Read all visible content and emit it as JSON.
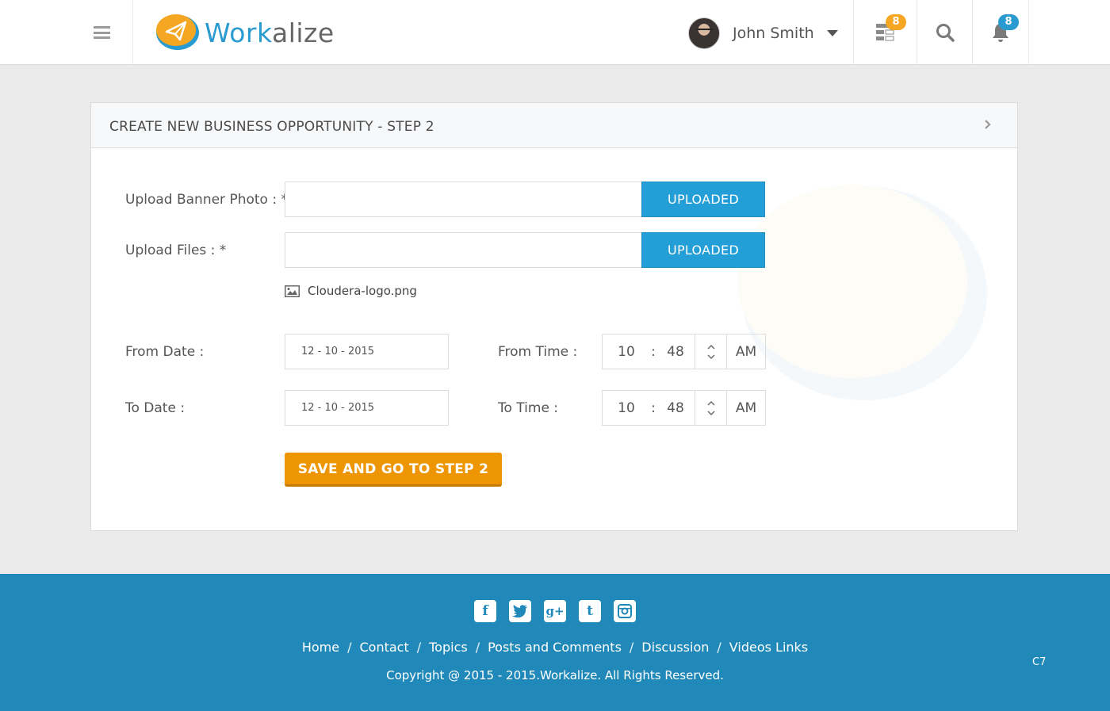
{
  "header": {
    "logo": {
      "part1": "Work",
      "part2": "alize"
    },
    "user_name": "John Smith",
    "messages_count": "8",
    "notifications_count": "8"
  },
  "panel": {
    "title": "CREATE NEW BUSINESS OPPORTUNITY - STEP 2"
  },
  "form": {
    "banner_label": "Upload Banner Photo : *",
    "banner_button": "UPLOADED",
    "files_label": "Upload Files : *",
    "files_button": "UPLOADED",
    "uploaded_file": "Cloudera-logo.png",
    "from_date_label": "From Date :",
    "from_date_value": "12 - 10 - 2015",
    "to_date_label": "To Date :",
    "to_date_value": "12 - 10 - 2015",
    "from_time_label": "From Time :",
    "from_time": {
      "hour": "10",
      "minute": "48",
      "period": "AM"
    },
    "to_time_label": "To Time :",
    "to_time": {
      "hour": "10",
      "minute": "48",
      "period": "AM"
    },
    "time_separator": ":",
    "submit": "SAVE AND GO TO STEP 2"
  },
  "footer": {
    "socials": [
      "facebook-icon",
      "twitter-icon",
      "google-plus-icon",
      "tumblr-icon",
      "instagram-icon"
    ],
    "nav": [
      "Home",
      "Contact",
      "Topics",
      "Posts and Comments",
      "Discussion",
      "Videos Links"
    ],
    "separator": "/",
    "copyright": "Copyright @ 2015 - 2015.Workalize. All Rights Reserved.",
    "code": "C7"
  },
  "colors": {
    "brand_blue": "#2a9bd0",
    "accent_orange": "#ee9504",
    "footer_bg": "#2189b9"
  }
}
